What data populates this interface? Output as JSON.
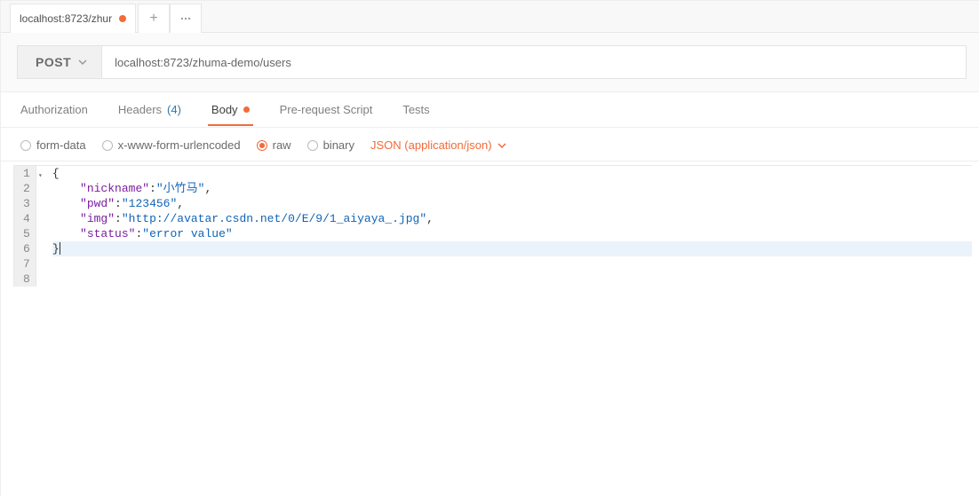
{
  "tab": {
    "label": "localhost:8723/zhur",
    "modified": true
  },
  "request": {
    "method": "POST",
    "url": "localhost:8723/zhuma-demo/users"
  },
  "subtabs": {
    "authorization": "Authorization",
    "headers": "Headers",
    "headers_count": "(4)",
    "body": "Body",
    "prerequest": "Pre-request Script",
    "tests": "Tests",
    "active": "body"
  },
  "bodyTypes": {
    "formdata": "form-data",
    "urlencoded": "x-www-form-urlencoded",
    "raw": "raw",
    "binary": "binary",
    "selected": "raw",
    "contentType": "JSON (application/json)"
  },
  "editor": {
    "lines": [
      {
        "n": "1",
        "tokens": [
          [
            "punc",
            "{"
          ]
        ],
        "fold": true
      },
      {
        "n": "2",
        "tokens": [
          [
            "indent",
            "    "
          ],
          [
            "key",
            "\"nickname\""
          ],
          [
            "punc",
            ":"
          ],
          [
            "str",
            "\"小竹马\""
          ],
          [
            "punc",
            ","
          ]
        ]
      },
      {
        "n": "3",
        "tokens": [
          [
            "indent",
            "    "
          ],
          [
            "key",
            "\"pwd\""
          ],
          [
            "punc",
            ":"
          ],
          [
            "str",
            "\"123456\""
          ],
          [
            "punc",
            ","
          ]
        ]
      },
      {
        "n": "4",
        "tokens": [
          [
            "indent",
            "    "
          ],
          [
            "key",
            "\"img\""
          ],
          [
            "punc",
            ":"
          ],
          [
            "str",
            "\"http://avatar.csdn.net/0/E/9/1_aiyaya_.jpg\""
          ],
          [
            "punc",
            ","
          ]
        ]
      },
      {
        "n": "5",
        "tokens": [
          [
            "indent",
            "    "
          ],
          [
            "key",
            "\"status\""
          ],
          [
            "punc",
            ":"
          ],
          [
            "str",
            "\"error value\""
          ]
        ]
      },
      {
        "n": "6",
        "tokens": [
          [
            "punc",
            "}"
          ]
        ],
        "highlight": true,
        "cursor": true
      },
      {
        "n": "7",
        "tokens": []
      },
      {
        "n": "8",
        "tokens": []
      }
    ]
  }
}
